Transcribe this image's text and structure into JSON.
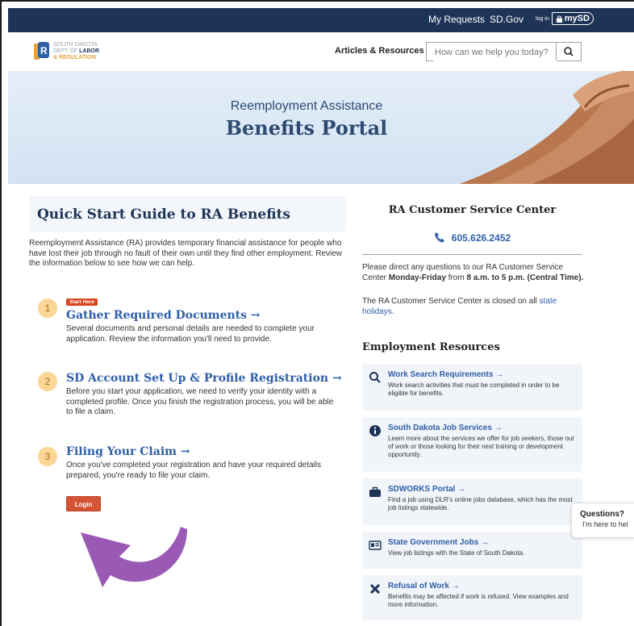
{
  "topbar": {
    "my_requests": "My Requests",
    "sdgov": "SD.Gov",
    "login_small": "log in",
    "mysd": "mySD"
  },
  "header": {
    "logo": {
      "line1": "SOUTH DAKOTA",
      "line2a": "DEPT OF ",
      "line2b": "LABOR",
      "line3": "& REGULATION"
    },
    "articles_link": "Articles & Resources",
    "search_placeholder": "How can we help you today?"
  },
  "hero": {
    "subtitle": "Reemployment Assistance",
    "title": "Benefits Portal"
  },
  "quick_start": {
    "title": "Quick Start Guide to RA Benefits",
    "intro": "Reemployment Assistance (RA) provides temporary financial assistance for people who have lost their job through no fault of their own until they find other employment. Review the information below to see how we can help.",
    "start_tag": "Start Here",
    "steps": [
      {
        "num": "1",
        "title": "Gather Required Documents →",
        "desc": "Several documents and personal details are needed to complete your application. Review the information you'll need to provide."
      },
      {
        "num": "2",
        "title": "SD Account Set Up & Profile Registration →",
        "desc": "Before you start your application, we need to verify your identity with a completed profile. Once you finish the registration process, you will be able to file a claim."
      },
      {
        "num": "3",
        "title": "Filing Your Claim →",
        "desc": "Once you've completed your registration and have your required details prepared, you're ready to file your claim."
      }
    ],
    "login_button": "Login"
  },
  "customer_service": {
    "title": "RA Customer Service Center",
    "phone": "605.626.2452",
    "p1_a": "Please direct any questions to our RA Customer Service Center ",
    "p1_b": "Monday-Friday",
    "p1_c": " from ",
    "p1_d": "8 a.m. to 5 p.m. (Central Time).",
    "p2_a": "The RA Customer Service Center is closed on all ",
    "p2_link": "state holidays",
    "p2_b": "."
  },
  "employment_resources": {
    "title": "Employment Resources",
    "items": [
      {
        "icon": "search-icon",
        "title": "Work Search Requirements →",
        "desc": "Work search activities that must be completed in order to be eligible for benefits."
      },
      {
        "icon": "info-icon",
        "title": "South Dakota Job Services →",
        "desc": "Learn more about the services we offer for job seekers, those out of work or those looking for their next training or development opportunity."
      },
      {
        "icon": "briefcase-icon",
        "title": "SDWORKS Portal →",
        "desc": "Find a job using DLR's online jobs database, which has the most job listings statewide."
      },
      {
        "icon": "id-card-icon",
        "title": "State Government Jobs →",
        "desc": "View job listings with the State of South Dakota."
      },
      {
        "icon": "x-icon",
        "title": "Refusal of Work →",
        "desc": "Benefits may be affected if work is refused. View examples and more information."
      }
    ]
  },
  "chat": {
    "title": "Questions?",
    "text": "I'm here to hel"
  },
  "colors": {
    "topbar": "#1e3456",
    "link": "#2f5ea8",
    "step_badge": "#fbd694",
    "login": "#d45434",
    "arrow": "#9b59b6"
  }
}
